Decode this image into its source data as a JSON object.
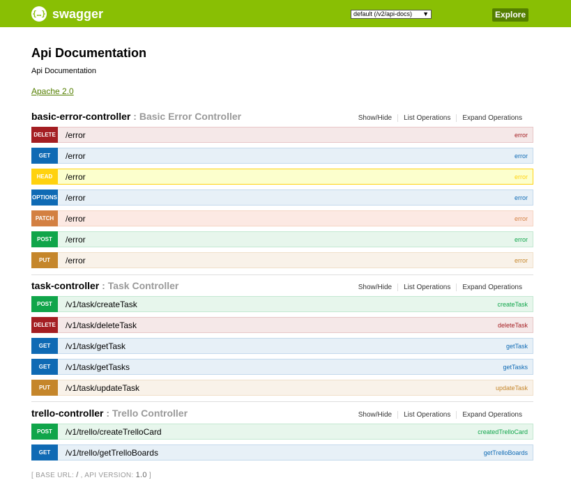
{
  "header": {
    "logo_glyph": "{…}",
    "logo_text": "swagger",
    "api_select_value": "default (/v2/api-docs)",
    "explore_label": "Explore",
    "colors": {
      "bar": "#89bf04",
      "explore": "#547f00"
    }
  },
  "info": {
    "title": "Api Documentation",
    "description": "Api Documentation",
    "license": "Apache 2.0"
  },
  "resource_links": {
    "show_hide": "Show/Hide",
    "list_ops": "List Operations",
    "expand_ops": "Expand Operations"
  },
  "resources": [
    {
      "name": "basic-error-controller",
      "separator": " : ",
      "description": "Basic Error Controller",
      "operations": [
        {
          "method": "DELETE",
          "path": "/error",
          "nickname": "error"
        },
        {
          "method": "GET",
          "path": "/error",
          "nickname": "error"
        },
        {
          "method": "HEAD",
          "path": "/error",
          "nickname": "error"
        },
        {
          "method": "OPTIONS",
          "path": "/error",
          "nickname": "error"
        },
        {
          "method": "PATCH",
          "path": "/error",
          "nickname": "error"
        },
        {
          "method": "POST",
          "path": "/error",
          "nickname": "error"
        },
        {
          "method": "PUT",
          "path": "/error",
          "nickname": "error"
        }
      ]
    },
    {
      "name": "task-controller",
      "separator": " : ",
      "description": "Task Controller",
      "operations": [
        {
          "method": "POST",
          "path": "/v1/task/createTask",
          "nickname": "createTask"
        },
        {
          "method": "DELETE",
          "path": "/v1/task/deleteTask",
          "nickname": "deleteTask"
        },
        {
          "method": "GET",
          "path": "/v1/task/getTask",
          "nickname": "getTask"
        },
        {
          "method": "GET",
          "path": "/v1/task/getTasks",
          "nickname": "getTasks"
        },
        {
          "method": "PUT",
          "path": "/v1/task/updateTask",
          "nickname": "updateTask"
        }
      ]
    },
    {
      "name": "trello-controller",
      "separator": " : ",
      "description": "Trello Controller",
      "operations": [
        {
          "method": "POST",
          "path": "/v1/trello/createTrelloCard",
          "nickname": "createdTrelloCard"
        },
        {
          "method": "GET",
          "path": "/v1/trello/getTrelloBoards",
          "nickname": "getTrelloBoards"
        }
      ]
    }
  ],
  "footer": {
    "open": "[ ",
    "base_url_label": "BASE URL: ",
    "base_url": "/",
    "sep": " , ",
    "api_version_label": "API VERSION: ",
    "api_version": "1.0",
    "close": " ]"
  }
}
